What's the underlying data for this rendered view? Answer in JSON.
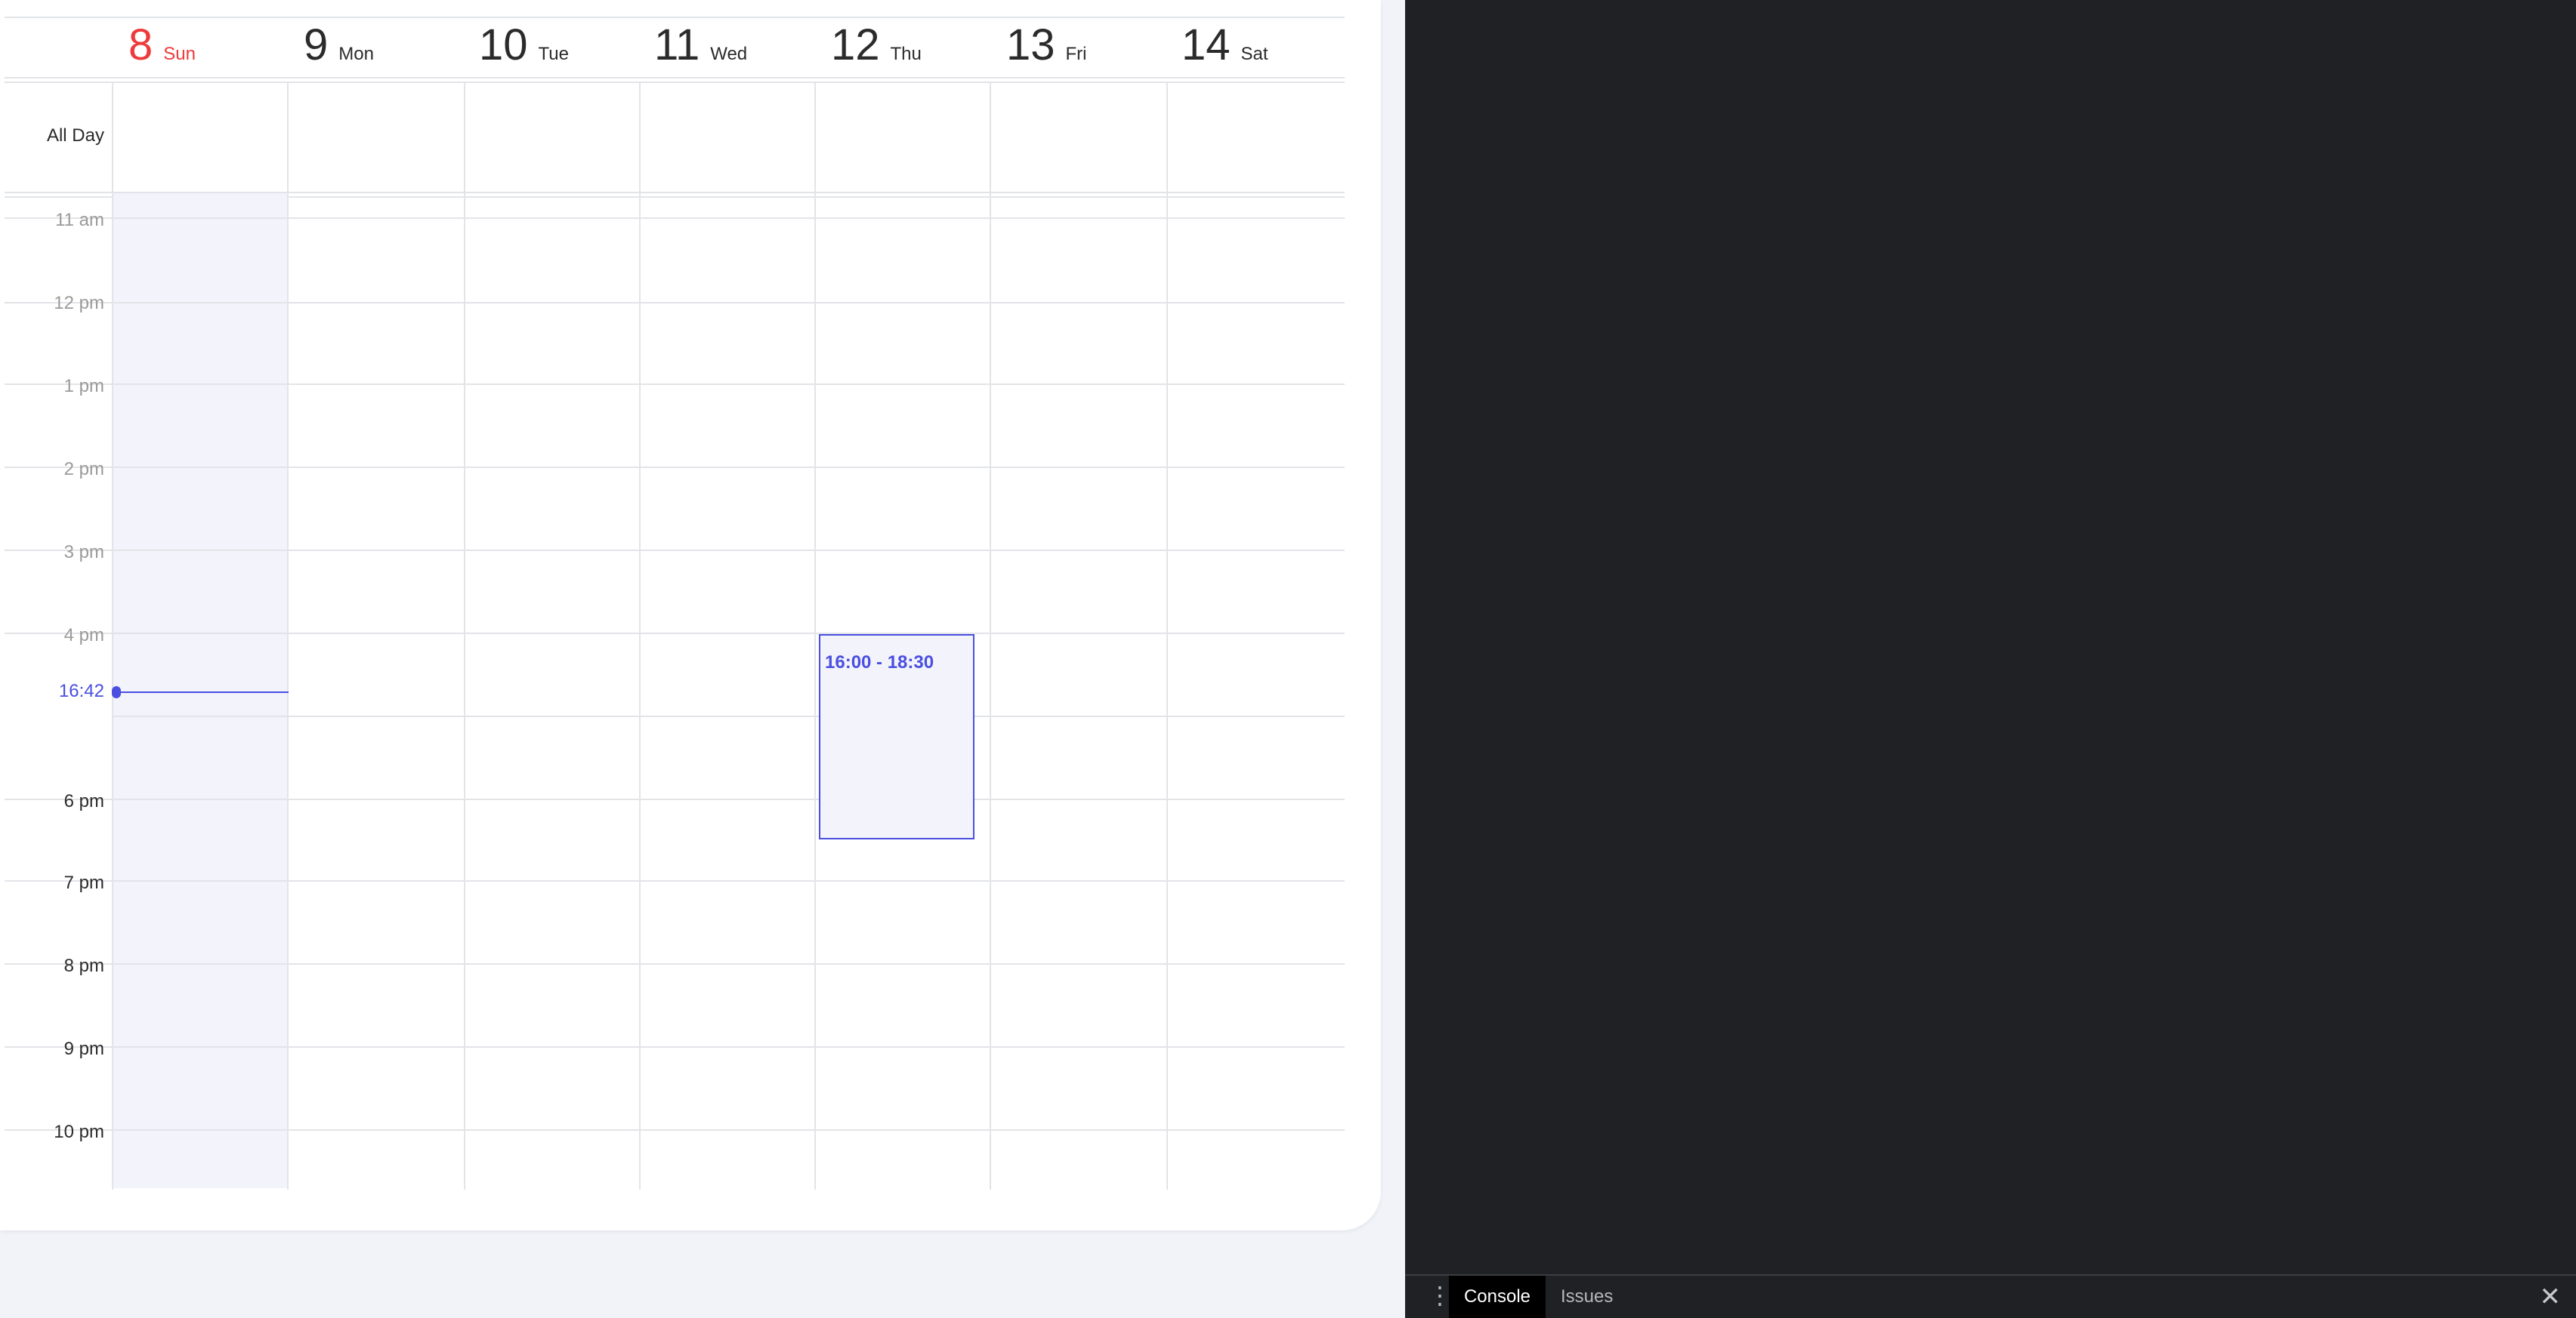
{
  "calendar": {
    "days": [
      {
        "num": "8",
        "name": "Sun",
        "today": true
      },
      {
        "num": "9",
        "name": "Mon",
        "today": false
      },
      {
        "num": "10",
        "name": "Tue",
        "today": false
      },
      {
        "num": "11",
        "name": "Wed",
        "today": false
      },
      {
        "num": "12",
        "name": "Thu",
        "today": false
      },
      {
        "num": "13",
        "name": "Fri",
        "today": false
      },
      {
        "num": "14",
        "name": "Sat",
        "today": false
      }
    ],
    "all_day_label": "All Day",
    "hours": [
      "11 am",
      "12 pm",
      "1 pm",
      "2 pm",
      "3 pm",
      "4 pm",
      "6 pm",
      "7 pm",
      "8 pm",
      "9 pm",
      "10 pm"
    ],
    "now_time": "16:42",
    "event": {
      "time": "16:00 - 18:30",
      "day": "Thu"
    },
    "accent_color": "#4a4fe0",
    "today_color": "#ee3a3a"
  },
  "devtools": {
    "menu_icon": "more-vert-icon",
    "tabs": [
      "Console",
      "Issues"
    ],
    "active_tab": "Console",
    "close_icon": "close-icon"
  }
}
